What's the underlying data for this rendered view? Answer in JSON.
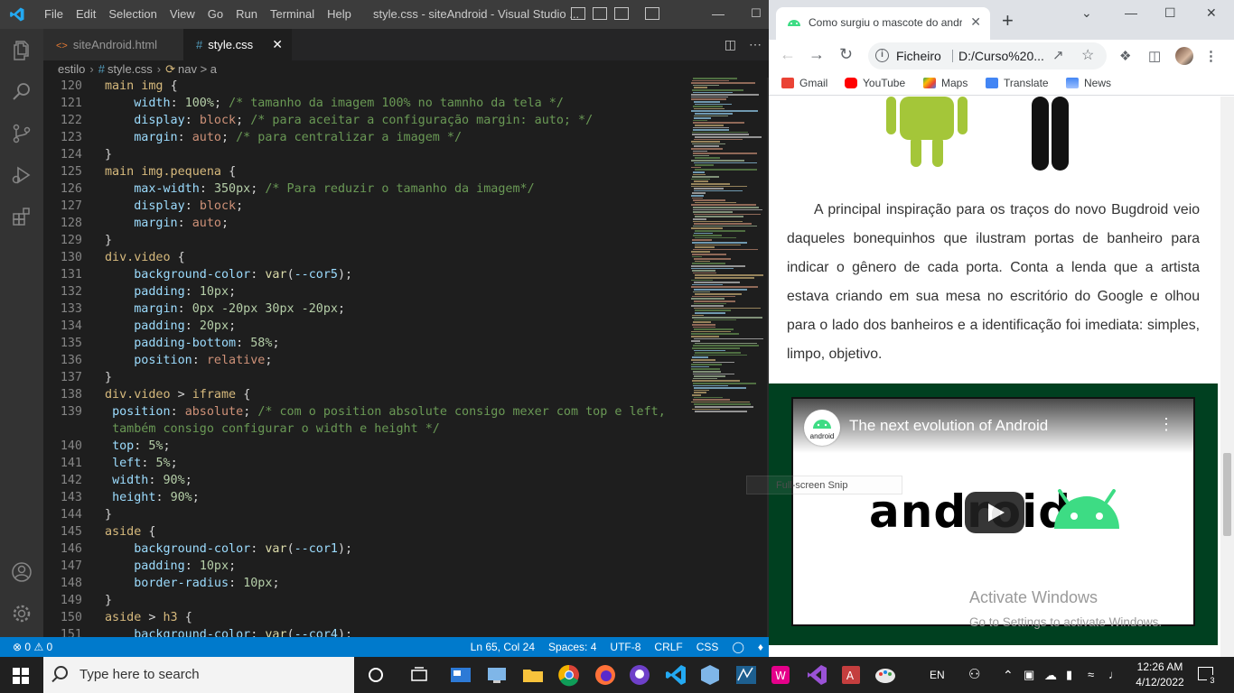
{
  "vscode": {
    "menu": [
      "File",
      "Edit",
      "Selection",
      "View",
      "Go",
      "Run",
      "Terminal",
      "Help"
    ],
    "window_title": "style.css - siteAndroid - Visual Studio ...",
    "tabs": [
      {
        "label": "siteAndroid.html",
        "icon": "<>"
      },
      {
        "label": "style.css",
        "icon": "#"
      }
    ],
    "breadcrumb": {
      "folder": "estilo",
      "file": "style.css",
      "symbol": "nav > a"
    },
    "code_lines": [
      {
        "n": "120",
        "html": "<span class='s'>main img</span> <span class='w'>{</span>"
      },
      {
        "n": "121",
        "html": "    <span class='p'>width</span><span class='w'>: </span><span class='v'>100%</span><span class='w'>; </span><span class='c'>/* tamanho da imagem 100% no tamnho da tela */</span>"
      },
      {
        "n": "122",
        "html": "    <span class='p'>display</span><span class='w'>: </span><span class='k'>block</span><span class='w'>; </span><span class='c'>/* para aceitar a configuração margin: auto; */</span>"
      },
      {
        "n": "123",
        "html": "    <span class='p'>margin</span><span class='w'>: </span><span class='k'>auto</span><span class='w'>; </span><span class='c'>/* para centralizar a imagem */</span>"
      },
      {
        "n": "124",
        "html": "<span class='w'>}</span>"
      },
      {
        "n": "125",
        "html": "<span class='s'>main img.pequena</span> <span class='w'>{</span>"
      },
      {
        "n": "126",
        "html": "    <span class='p'>max-width</span><span class='w'>: </span><span class='v'>350px</span><span class='w'>; </span><span class='c'>/* Para reduzir o tamanho da imagem*/</span>"
      },
      {
        "n": "127",
        "html": "    <span class='p'>display</span><span class='w'>: </span><span class='k'>block</span><span class='w'>;</span>"
      },
      {
        "n": "128",
        "html": "    <span class='p'>margin</span><span class='w'>: </span><span class='k'>auto</span><span class='w'>;</span>"
      },
      {
        "n": "129",
        "html": "<span class='w'>}</span>"
      },
      {
        "n": "130",
        "html": "<span class='s'>div.video</span> <span class='w'>{</span>"
      },
      {
        "n": "131",
        "html": "    <span class='p'>background-color</span><span class='w'>: </span><span class='f'>var</span><span class='w'>(</span><span class='p'>--cor5</span><span class='w'>);</span>"
      },
      {
        "n": "132",
        "html": "    <span class='p'>padding</span><span class='w'>: </span><span class='v'>10px</span><span class='w'>;</span>"
      },
      {
        "n": "133",
        "html": "    <span class='p'>margin</span><span class='w'>: </span><span class='v'>0px -20px 30px -20px</span><span class='w'>;</span>"
      },
      {
        "n": "134",
        "html": "    <span class='p'>padding</span><span class='w'>: </span><span class='v'>20px</span><span class='w'>;</span>"
      },
      {
        "n": "135",
        "html": "    <span class='p'>padding-bottom</span><span class='w'>: </span><span class='v'>58%</span><span class='w'>;</span>"
      },
      {
        "n": "136",
        "html": "    <span class='p'>position</span><span class='w'>: </span><span class='k'>relative</span><span class='w'>;</span>"
      },
      {
        "n": "137",
        "html": "<span class='w'>}</span>"
      },
      {
        "n": "138",
        "html": "<span class='s'>div.video</span> <span class='w'>&gt;</span> <span class='s'>iframe</span> <span class='w'>{</span>"
      },
      {
        "n": "139",
        "html": " <span class='p'>position</span><span class='w'>: </span><span class='k'>absolute</span><span class='w'>; </span><span class='c'>/* com o position absolute consigo mexer com top e left,</span>"
      },
      {
        "n": "",
        "html": " <span class='c'>também consigo configurar o width e height */</span>"
      },
      {
        "n": "140",
        "html": " <span class='p'>top</span><span class='w'>: </span><span class='v'>5%</span><span class='w'>;</span>"
      },
      {
        "n": "141",
        "html": " <span class='p'>left</span><span class='w'>: </span><span class='v'>5%</span><span class='w'>;</span>"
      },
      {
        "n": "142",
        "html": " <span class='p'>width</span><span class='w'>: </span><span class='v'>90%</span><span class='w'>;</span>"
      },
      {
        "n": "143",
        "html": " <span class='p'>height</span><span class='w'>: </span><span class='v'>90%</span><span class='w'>;</span>"
      },
      {
        "n": "144",
        "html": "<span class='w'>}</span>"
      },
      {
        "n": "145",
        "html": "<span class='s'>aside</span> <span class='w'>{</span>"
      },
      {
        "n": "146",
        "html": "    <span class='p'>background-color</span><span class='w'>: </span><span class='f'>var</span><span class='w'>(</span><span class='p'>--cor1</span><span class='w'>);</span>"
      },
      {
        "n": "147",
        "html": "    <span class='p'>padding</span><span class='w'>: </span><span class='v'>10px</span><span class='w'>;</span>"
      },
      {
        "n": "148",
        "html": "    <span class='p'>border-radius</span><span class='w'>: </span><span class='v'>10px</span><span class='w'>;</span>"
      },
      {
        "n": "149",
        "html": "<span class='w'>}</span>"
      },
      {
        "n": "150",
        "html": "<span class='s'>aside</span> <span class='w'>&gt;</span> <span class='s'>h3</span> <span class='w'>{</span>"
      },
      {
        "n": "151",
        "html": "    <span class='p'>background-color</span><span class='w'>: </span><span class='f'>var</span><span class='w'>(</span><span class='p'>--cor4</span><span class='w'>);</span>"
      }
    ],
    "status": {
      "errors": "0",
      "warnings": "0",
      "position": "Ln 65, Col 24",
      "spaces": "Spaces: 4",
      "encoding": "UTF-8",
      "eol": "CRLF",
      "language": "CSS"
    },
    "colors": {
      "accent": "#007acc",
      "titlebar": "#3c3c3c",
      "editor_bg": "#1e1e1e"
    }
  },
  "chrome": {
    "tab_title": "Como surgiu o mascote do andr...",
    "omnibox": {
      "scheme": "Ficheiro",
      "url": "D:/Curso%20..."
    },
    "bookmarks": [
      {
        "label": "Gmail",
        "color": "#ea4335"
      },
      {
        "label": "YouTube",
        "color": "#ff0000"
      },
      {
        "label": "Maps",
        "color": "#34a853"
      },
      {
        "label": "Translate",
        "color": "#4285f4"
      },
      {
        "label": "News",
        "color": "#4285f4"
      }
    ],
    "paragraph": "A principal inspiração para os traços do novo Bugdroid veio daqueles bonequinhos que ilustram portas de banheiro para indicar o gênero de cada porta. Conta a lenda que a artista estava criando em sua mesa no escritório do Google e olhou para o lado dos banheiros e a identificação foi imediata: simples, limpo, objetivo.",
    "video": {
      "title": "The next evolution of Android",
      "channel_label": "android",
      "wordmark": "android"
    },
    "activate": {
      "line1": "Activate Windows",
      "line2": "Go to Settings to activate Windows."
    },
    "colors": {
      "video_bg": "#004020",
      "android_green": "#3ddc84"
    }
  },
  "snip_tooltip": "Full-screen Snip",
  "taskbar": {
    "search_placeholder": "Type here to search",
    "language": "EN",
    "time": "12:26 AM",
    "date": "4/12/2022",
    "notification_count": "3"
  }
}
